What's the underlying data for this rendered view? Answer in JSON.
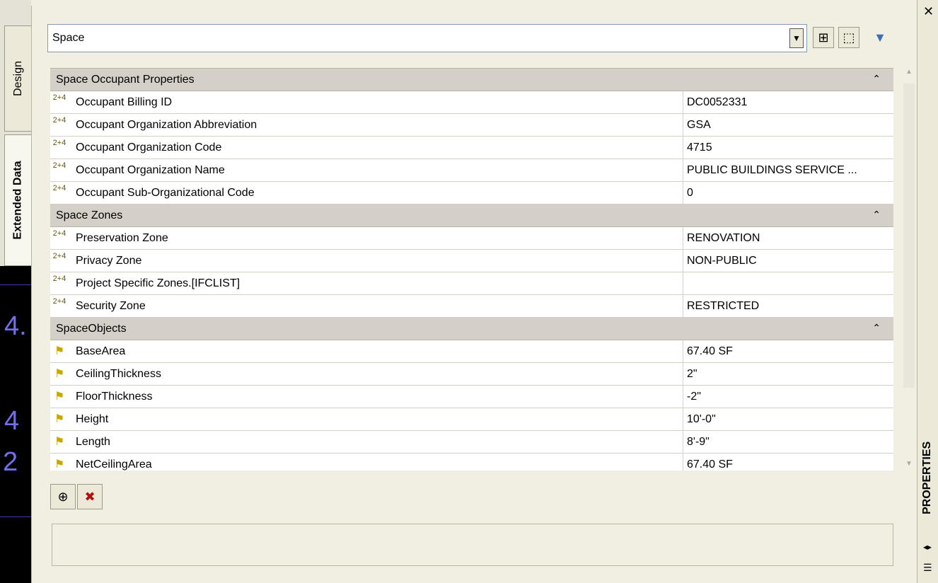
{
  "object_selector": {
    "value": "Space"
  },
  "toolbar": {
    "quick_select_icon": "quick-select-icon",
    "select_objects_icon": "select-objects-icon",
    "filter_icon": "filter-icon"
  },
  "tabs": [
    {
      "label": "Design"
    },
    {
      "label": "Extended Data"
    }
  ],
  "categories": [
    {
      "title": "Space Occupant Properties",
      "rows": [
        {
          "name": "Occupant Billing ID",
          "value": "DC0052331"
        },
        {
          "name": "Occupant Organization Abbreviation",
          "value": "GSA"
        },
        {
          "name": "Occupant Organization Code",
          "value": "4715"
        },
        {
          "name": "Occupant Organization Name",
          "value": "PUBLIC BUILDINGS SERVICE ..."
        },
        {
          "name": "Occupant Sub-Organizational Code",
          "value": "0"
        }
      ]
    },
    {
      "title": "Space Zones",
      "rows": [
        {
          "name": "Preservation Zone",
          "value": "RENOVATION"
        },
        {
          "name": "Privacy Zone",
          "value": "NON-PUBLIC"
        },
        {
          "name": "Project Specific Zones.[IFCLIST]",
          "value": ""
        },
        {
          "name": "Security Zone",
          "value": "RESTRICTED"
        }
      ]
    },
    {
      "title": "SpaceObjects",
      "rows": [
        {
          "name": "BaseArea",
          "value": "67.40 SF"
        },
        {
          "name": "CeilingThickness",
          "value": "2\""
        },
        {
          "name": "FloorThickness",
          "value": "-2\""
        },
        {
          "name": "Height",
          "value": "10'-0\""
        },
        {
          "name": "Length",
          "value": "8'-9\""
        },
        {
          "name": "NetCeilingArea",
          "value": "67.40 SF"
        }
      ]
    }
  ],
  "property_set_icon_text": "2+4",
  "drawing_numbers": [
    "4.",
    "4",
    "2"
  ],
  "palette_title": "PROPERTIES",
  "colors": {
    "background": "#f1efe2",
    "category_header": "#d4d0c8",
    "drawing_bg": "#000000",
    "drawing_text": "#6f6ff0"
  }
}
